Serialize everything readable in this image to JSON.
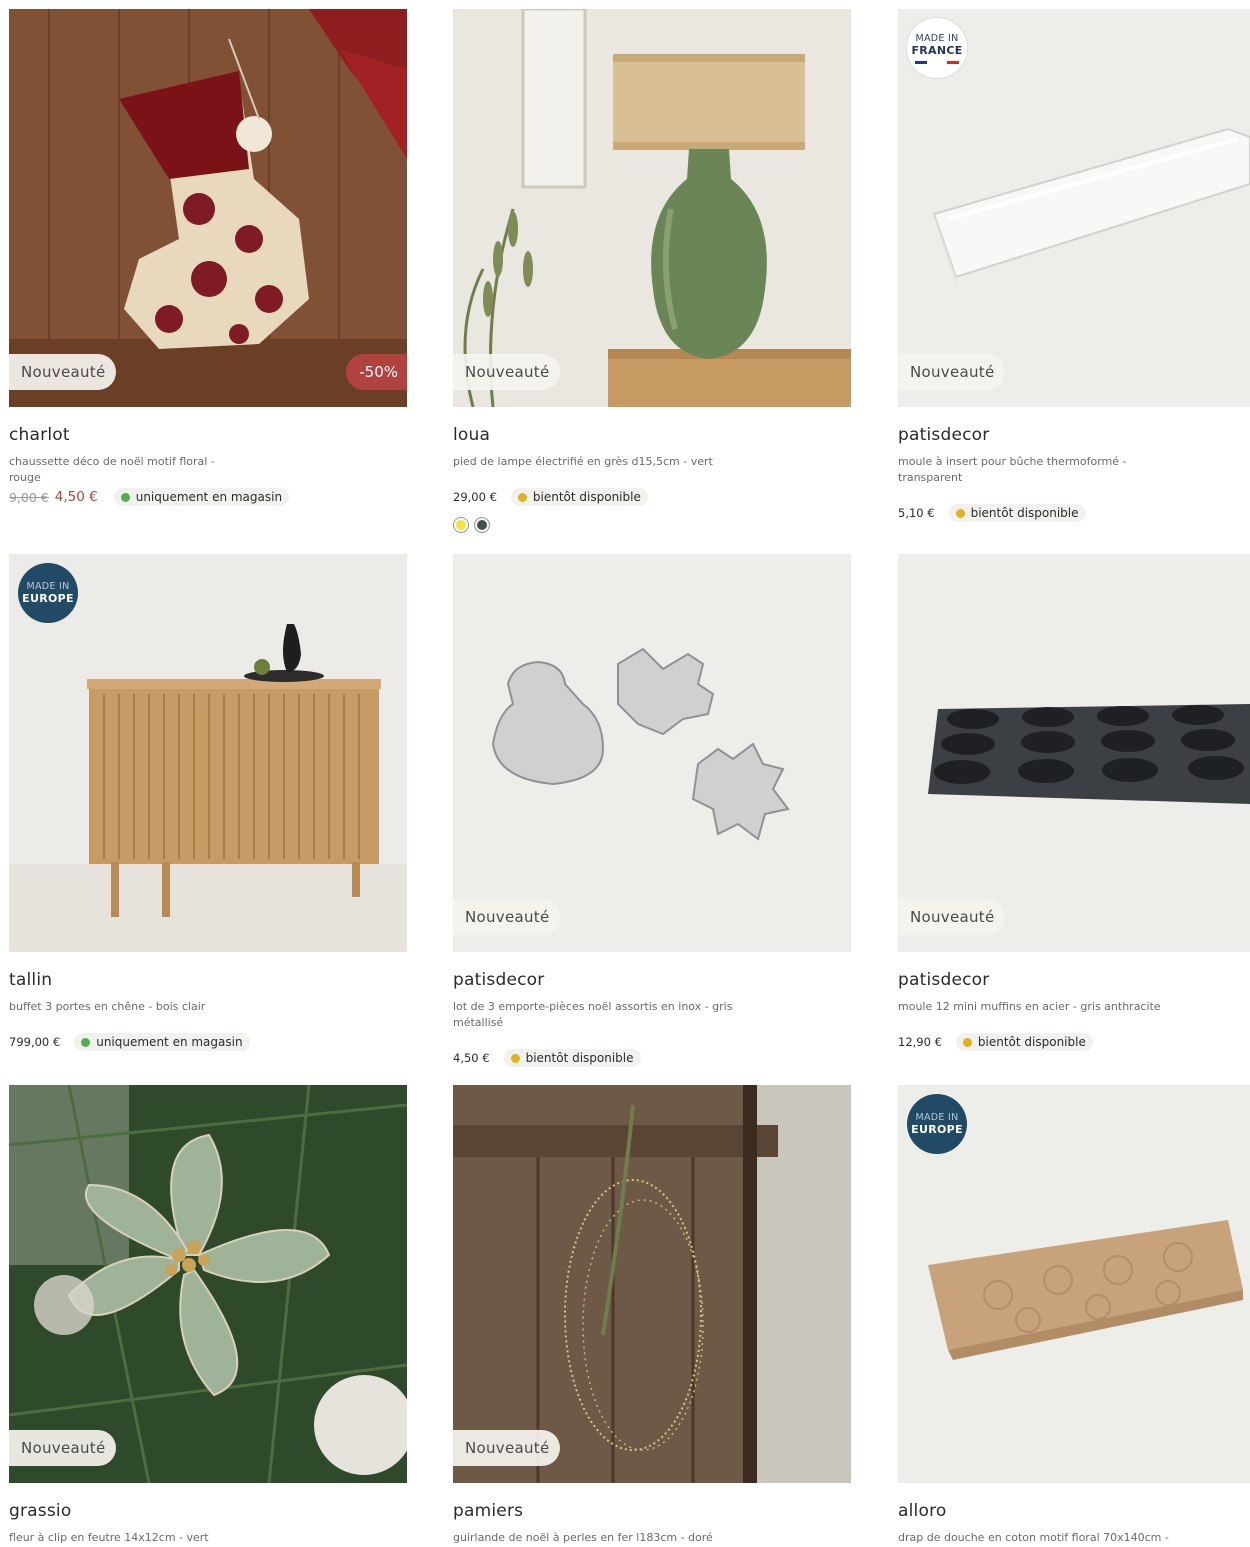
{
  "colors": {
    "available_store": "#4caf50",
    "coming_soon": "#e2b11b",
    "sale": "#b0433f"
  },
  "products": [
    {
      "brand": "charlot",
      "description": "chaussette déco de noël motif floral - rouge",
      "old_price": "9,00 €",
      "price": "4,50 €",
      "badge": "Nouveauté",
      "discount": "-50%",
      "availability": "uniquement en magasin"
    },
    {
      "brand": "loua",
      "description": "pied de lampe électrifié en grès d15,5cm - vert",
      "price": "29,00 €",
      "badge": "Nouveauté",
      "availability": "bientôt disponible",
      "swatches": [
        "#f2e63a",
        "#4a4e4a"
      ]
    },
    {
      "brand": "patisdecor",
      "description": "moule à insert pour bûche thermoformé - transparent",
      "price": "5,10 €",
      "badge": "Nouveauté",
      "availability": "bientôt disponible",
      "made_in_top": "MADE IN",
      "made_in": "FRANCE"
    },
    {
      "brand": "tallin",
      "description": "buffet 3 portes en chêne - bois clair",
      "price": "799,00 €",
      "availability": "uniquement en magasin",
      "made_in_top": "MADE IN",
      "made_in": "EUROPE"
    },
    {
      "brand": "patisdecor",
      "description": "lot de 3 emporte-pièces noël assortis en inox - gris métallisé",
      "price": "4,50 €",
      "badge": "Nouveauté",
      "availability": "bientôt disponible"
    },
    {
      "brand": "patisdecor",
      "description": "moule 12 mini muffins en acier - gris anthracite",
      "price": "12,90 €",
      "badge": "Nouveauté",
      "availability": "bientôt disponible"
    },
    {
      "brand": "grassio",
      "description": "fleur à clip en feutre 14x12cm - vert",
      "badge": "Nouveauté"
    },
    {
      "brand": "pamiers",
      "description": "guirlande de noël à perles en fer l183cm - doré",
      "badge": "Nouveauté"
    },
    {
      "brand": "alloro",
      "description": "drap de douche en coton motif floral 70x140cm -",
      "made_in_top": "MADE IN",
      "made_in": "EUROPE"
    }
  ]
}
